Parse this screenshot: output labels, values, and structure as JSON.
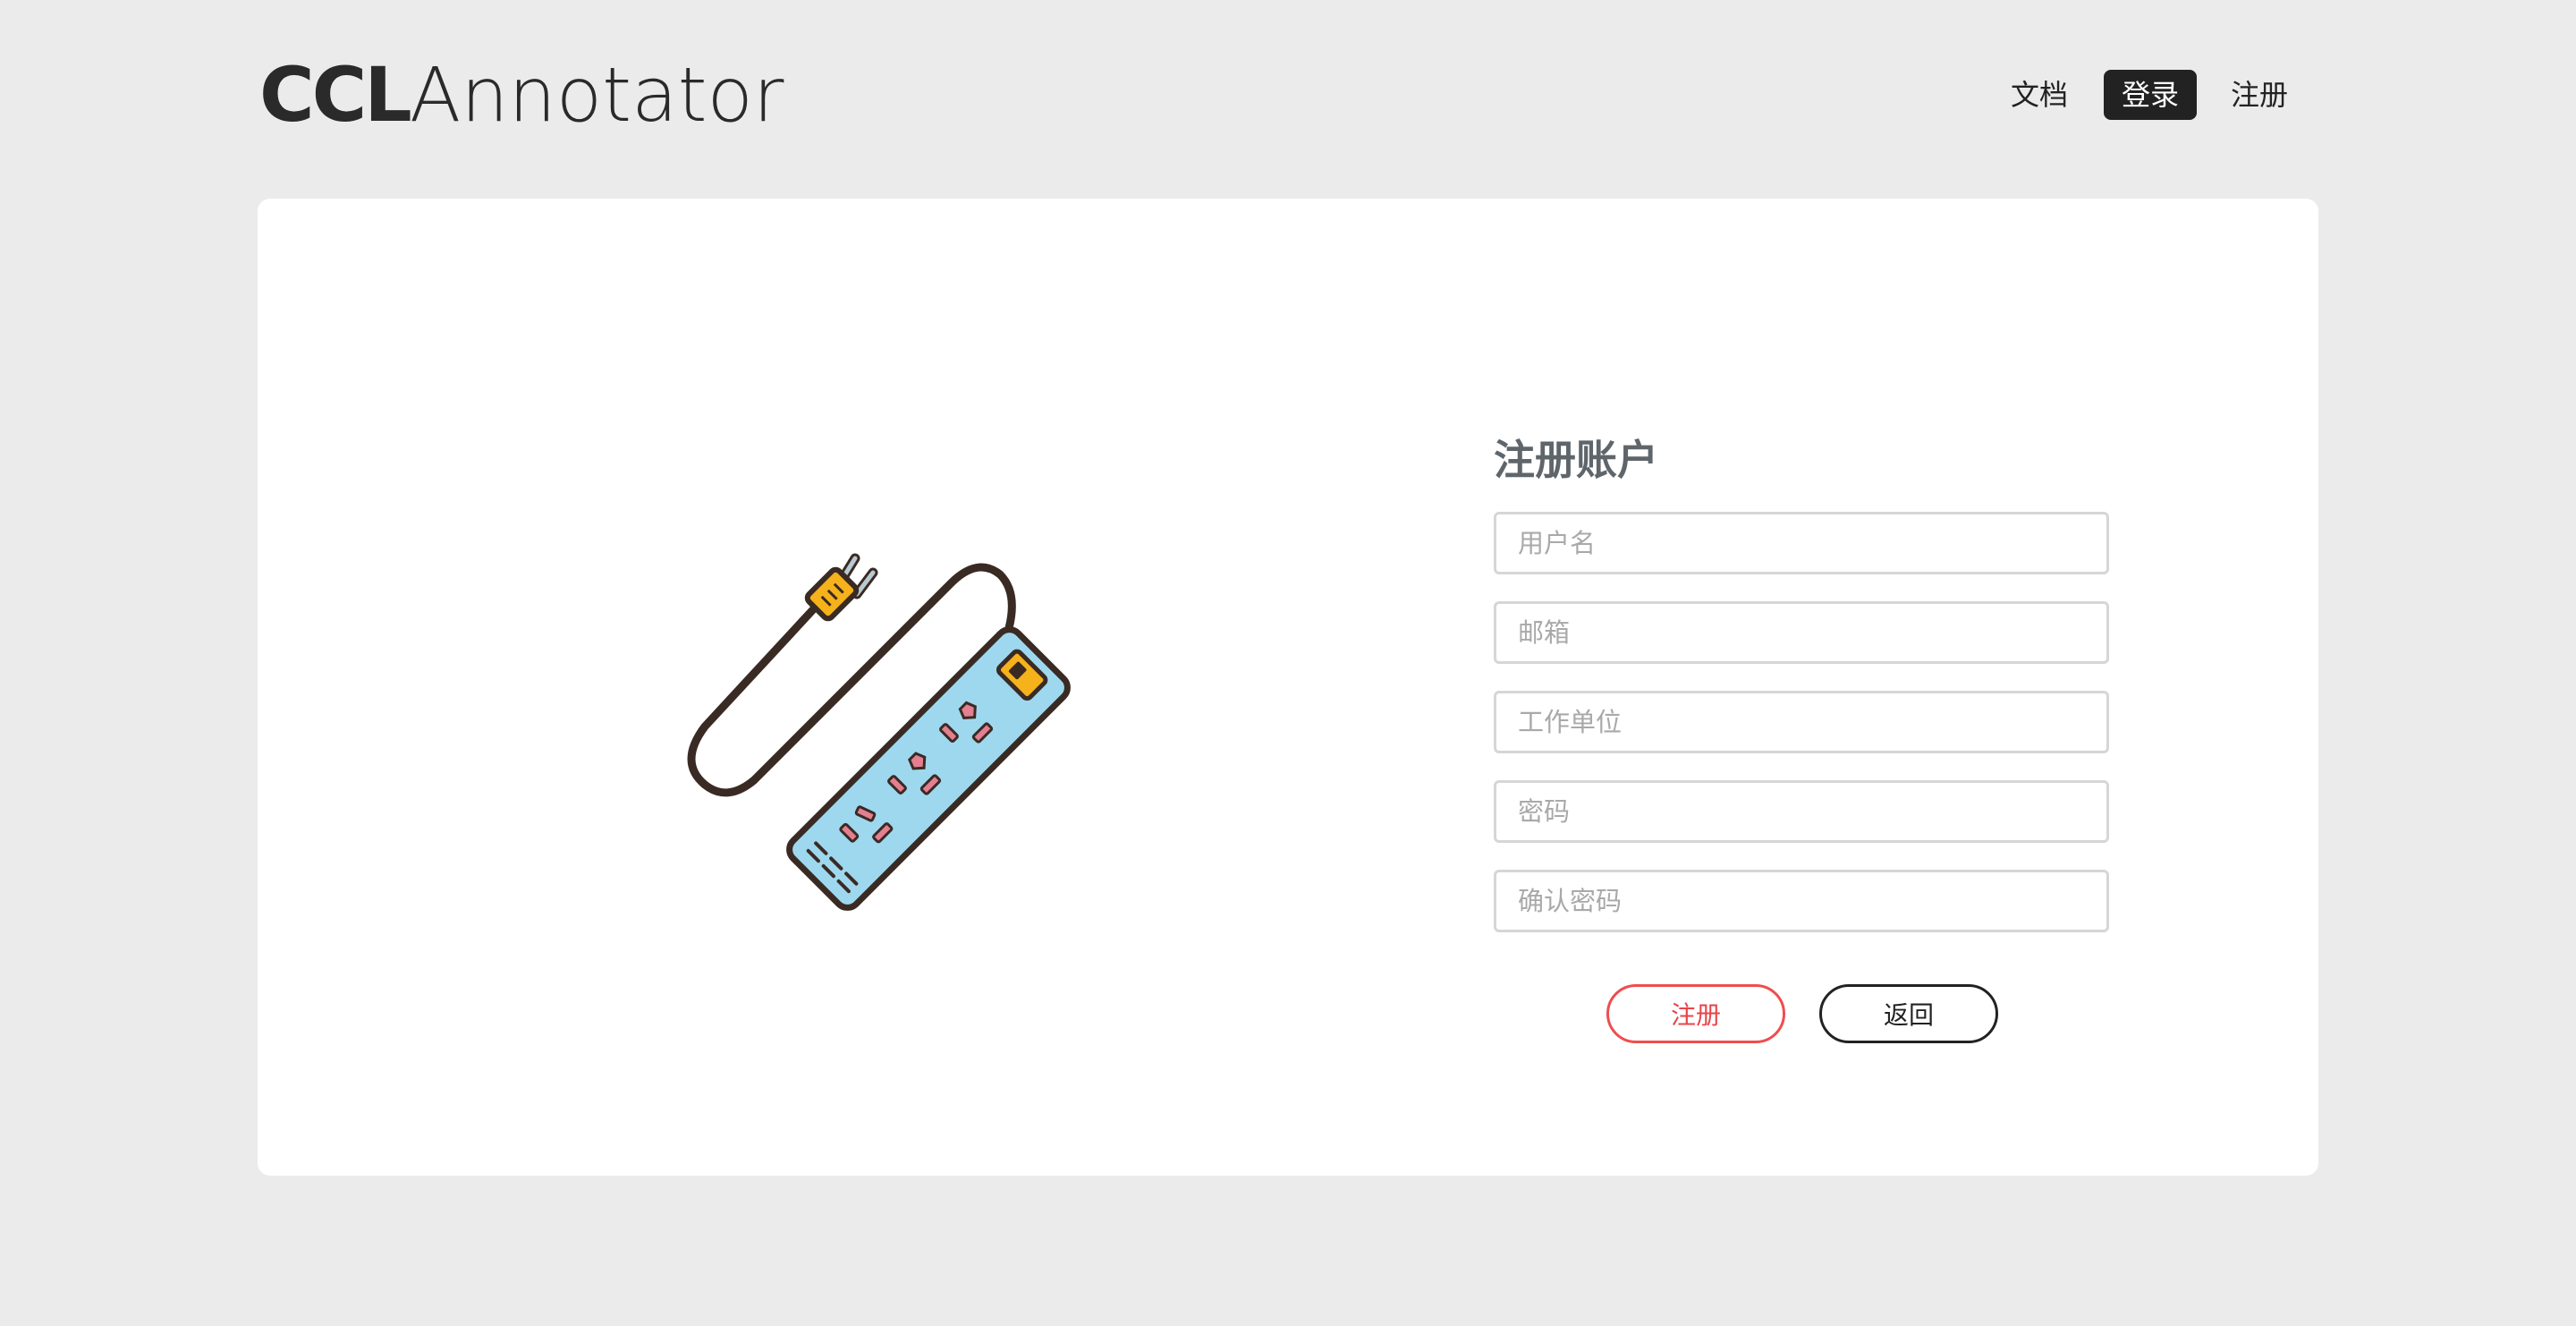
{
  "logo": {
    "bold": "CCL",
    "light": "Annotator"
  },
  "nav": {
    "docs": "文档",
    "login": "登录",
    "register": "注册"
  },
  "form": {
    "title": "注册账户",
    "username_placeholder": "用户名",
    "email_placeholder": "邮箱",
    "organization_placeholder": "工作单位",
    "password_placeholder": "密码",
    "confirm_password_placeholder": "确认密码",
    "register_button": "注册",
    "back_button": "返回"
  },
  "colors": {
    "page_background": "#ebebeb",
    "card_background": "#ffffff",
    "accent_red": "#ef4d4f",
    "nav_active_bg": "#222222"
  },
  "illustration": {
    "icon": "power-strip-icon"
  }
}
